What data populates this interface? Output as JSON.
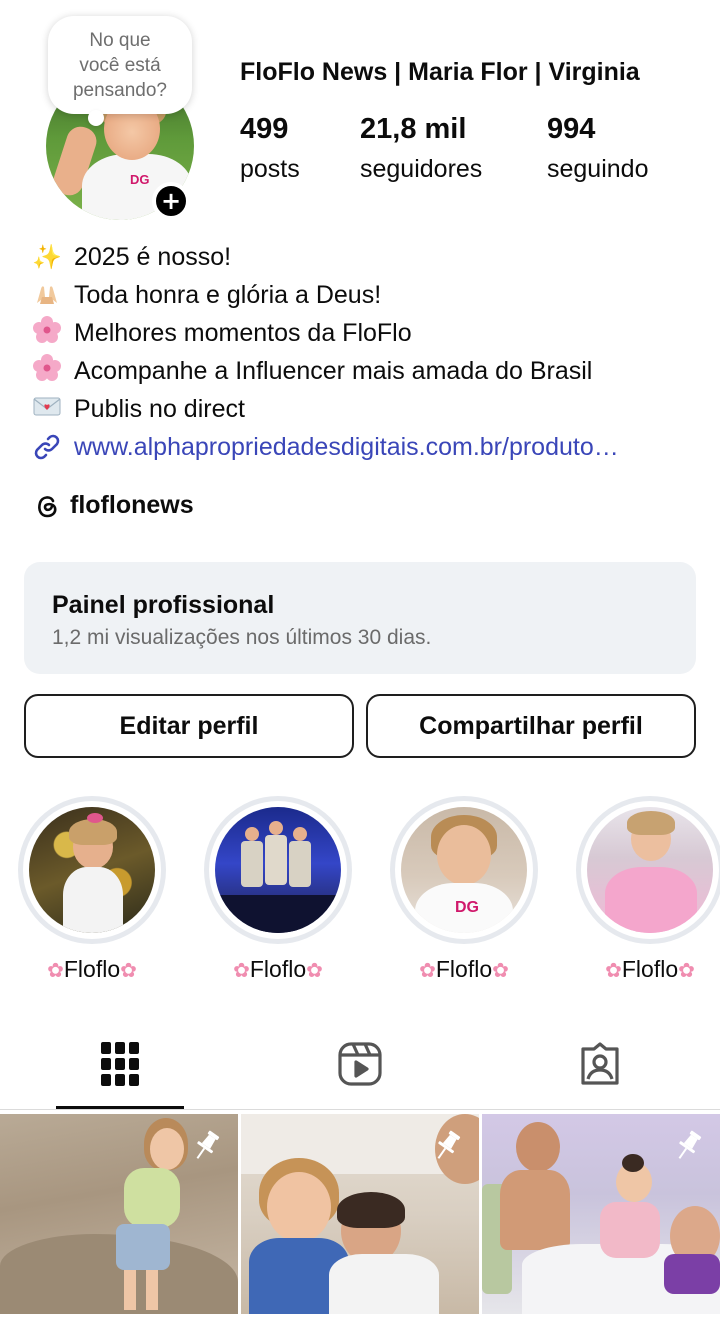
{
  "profile": {
    "name": "FloFlo News | Maria Flor | Virginia",
    "note_bubble": [
      "No que",
      "você está",
      "pensando?"
    ],
    "add_story_symbol": "+"
  },
  "stats": {
    "posts": {
      "value": "499",
      "label": "posts"
    },
    "followers": {
      "value": "21,8 mil",
      "label": "seguidores"
    },
    "following": {
      "value": "994",
      "label": "seguindo"
    }
  },
  "bio": {
    "lines": [
      {
        "emoji": "sparkles-icon",
        "text": "2025 é nosso!"
      },
      {
        "emoji": "raised-hands-icon",
        "text": "Toda honra e glória a Deus!"
      },
      {
        "emoji": "cherry-blossom-icon",
        "text": "Melhores momentos da FloFlo"
      },
      {
        "emoji": "cherry-blossom-icon",
        "text": "Acompanhe a Influencer mais amada do Brasil"
      },
      {
        "emoji": "love-letter-icon",
        "text": "Publis no direct"
      }
    ],
    "link": "www.alphapropriedadesdigitais.com.br/produto…"
  },
  "threads": {
    "handle": "floflonews"
  },
  "panel": {
    "title": "Painel profissional",
    "subtitle": "1,2 mi visualizações nos últimos 30 dias."
  },
  "buttons": {
    "edit": "Editar perfil",
    "share": "Compartilhar perfil"
  },
  "highlights": [
    {
      "label": "Floflo"
    },
    {
      "label": "Floflo"
    },
    {
      "label": "Floflo"
    },
    {
      "label": "Floflo"
    }
  ],
  "tabs": [
    "grid-icon",
    "reels-icon",
    "tagged-icon"
  ],
  "colors": {
    "link": "#3a46b8",
    "panel_bg": "#eff2f5",
    "highlight_ring": "#e6e9ee"
  }
}
